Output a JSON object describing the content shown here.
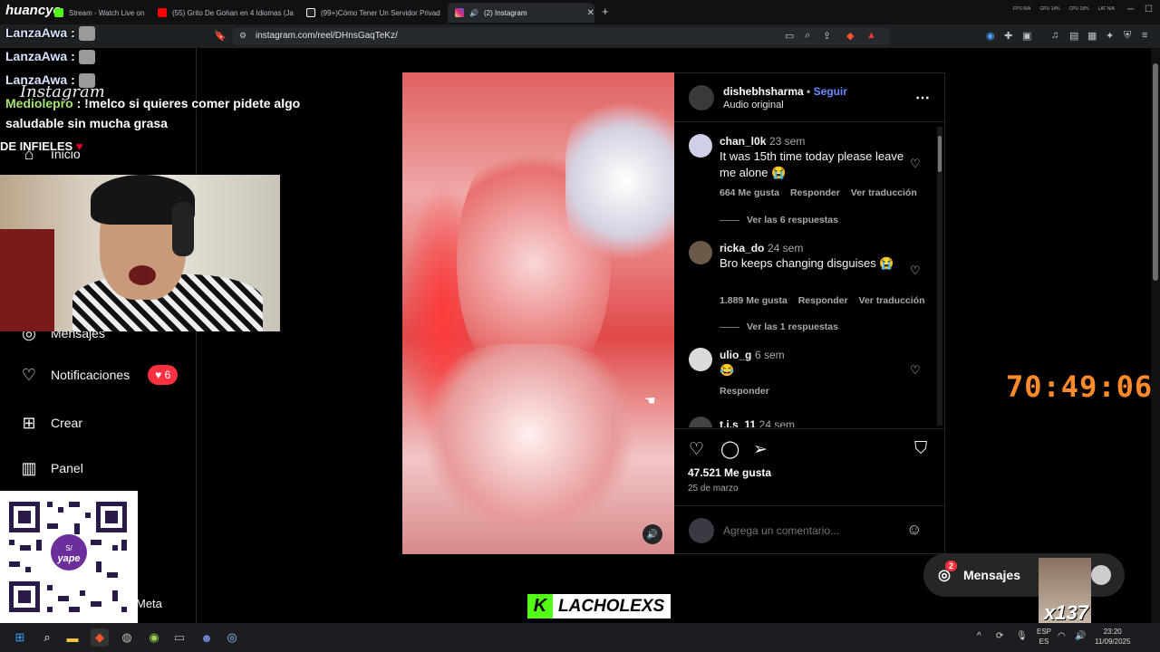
{
  "browser": {
    "tabs": [
      {
        "title": "Stream - Watch Live on Ki",
        "color": "#53fc18"
      },
      {
        "title": "(55) Grito De Gohan en 4 Idiomas (Ja",
        "color": "#ff0000"
      },
      {
        "title": "(99+)Cómo Tener Un Servidor Privad",
        "color": "#ffffff"
      },
      {
        "title": "(2) Instagram",
        "color": "#e1306c"
      }
    ],
    "url": "instagram.com/reel/DHnsGaqTeKz/",
    "stats": [
      "FPS N/A",
      "GPU 14%",
      "CPU 18%",
      "LAT N/A"
    ]
  },
  "overlay": {
    "logo": "huancyo",
    "chat": [
      {
        "user": "LanzaAwa",
        "text": ":"
      },
      {
        "user": "LanzaAwa",
        "text": ":"
      },
      {
        "user": "LanzaAwa",
        "text": ":"
      },
      {
        "user": "Mediolepro",
        "text": ": !melco si quieres comer pidete algo"
      },
      {
        "user": "",
        "text": "saludable sin mucha grasa"
      }
    ],
    "ig_wordmark": "Instagram",
    "banner": "DE INFIELES",
    "timer": "70:49:06",
    "brand": "LACHOLEXS",
    "brand_k": "K",
    "sub_count": "x137",
    "qr_label": "yape"
  },
  "sidebar": {
    "items": [
      {
        "label": "Inicio",
        "icon": "home-icon"
      },
      {
        "label": "Mensajes",
        "icon": "messenger-icon"
      },
      {
        "label": "Notificaciones",
        "icon": "heart-icon",
        "badge": "6"
      },
      {
        "label": "Crear",
        "icon": "plus-square-icon"
      },
      {
        "label": "Panel",
        "icon": "chart-icon"
      }
    ],
    "meta": "Meta"
  },
  "post": {
    "author": "dishebhsharma",
    "follow": "Seguir",
    "audio": "Audio original",
    "likes": "47.521 Me gusta",
    "date": "25 de marzo",
    "comment_placeholder": "Agrega un comentario...",
    "comments": [
      {
        "user": "chan_l0k",
        "time": "23 sem",
        "text": "It was 15th time today please leave me alone 😭",
        "likes": "664 Me gusta",
        "reply": "Responder",
        "translate": "Ver traducción",
        "replies": "Ver las 6 respuestas"
      },
      {
        "user": "ricka_do",
        "time": "24 sem",
        "text": "Bro keeps changing disguises 😭",
        "likes": "1.889 Me gusta",
        "reply": "Responder",
        "translate": "Ver traducción",
        "replies": "Ver las 1 respuestas"
      },
      {
        "user": "ulio_g",
        "time": "6 sem",
        "text": "😂",
        "reply": "Responder"
      },
      {
        "user": "t.i.s_11",
        "time": "24 sem"
      }
    ]
  },
  "messages_pill": {
    "label": "Mensajes",
    "badge": "2"
  },
  "taskbar": {
    "lang": "ESP",
    "lang2": "ES",
    "time": "23:20",
    "date": "11/09/2025"
  }
}
